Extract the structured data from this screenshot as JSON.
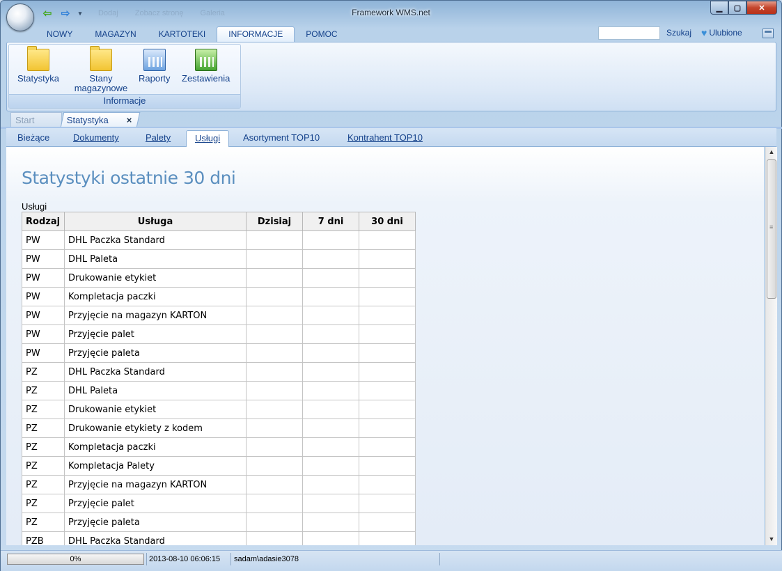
{
  "window": {
    "title": "Framework WMS.net",
    "ghost_qat": [
      "Dodaj",
      "Zobacz stronę",
      "Galeria"
    ]
  },
  "ribbon": {
    "tabs": [
      "NOWY",
      "MAGAZYN",
      "KARTOTEKI",
      "INFORMACJE",
      "POMOC"
    ],
    "active_tab": "INFORMACJE",
    "search_value": "",
    "search_label": "Szukaj",
    "favorites_label": "Ulubione",
    "group": {
      "label": "Informacje",
      "buttons": [
        {
          "label": "Statystyka",
          "icon": "folder-icon"
        },
        {
          "label": "Stany magazynowe",
          "icon": "folder-icon"
        },
        {
          "label": "Raporty",
          "icon": "bar-chart-icon"
        },
        {
          "label": "Zestawienia",
          "icon": "bar-chart-icon"
        }
      ]
    }
  },
  "doc_tabs": {
    "start": "Start",
    "active": "Statystyka",
    "close_glyph": "×"
  },
  "sub_tabs": [
    {
      "label": "Bieżące"
    },
    {
      "label": "Dokumenty"
    },
    {
      "label": "Palety"
    },
    {
      "label": "Usługi",
      "active": true
    },
    {
      "label": "Asortyment TOP10"
    },
    {
      "label": "Kontrahent TOP10"
    }
  ],
  "content": {
    "heading": "Statystyki ostatnie 30 dni",
    "table_caption": "Usługi",
    "columns": [
      "Rodzaj",
      "Usługa",
      "Dzisiaj",
      "7 dni",
      "30 dni"
    ],
    "rows": [
      [
        "PW",
        "DHL Paczka Standard",
        "",
        "",
        ""
      ],
      [
        "PW",
        "DHL Paleta",
        "",
        "",
        ""
      ],
      [
        "PW",
        "Drukowanie etykiet",
        "",
        "",
        ""
      ],
      [
        "PW",
        "Kompletacja paczki",
        "",
        "",
        ""
      ],
      [
        "PW",
        "Przyjęcie na magazyn KARTON",
        "",
        "",
        ""
      ],
      [
        "PW",
        "Przyjęcie palet",
        "",
        "",
        ""
      ],
      [
        "PW",
        "Przyjęcie paleta",
        "",
        "",
        ""
      ],
      [
        "PZ",
        "DHL Paczka Standard",
        "",
        "",
        ""
      ],
      [
        "PZ",
        "DHL Paleta",
        "",
        "",
        ""
      ],
      [
        "PZ",
        "Drukowanie etykiet",
        "",
        "",
        ""
      ],
      [
        "PZ",
        "Drukowanie etykiety z kodem",
        "",
        "",
        ""
      ],
      [
        "PZ",
        "Kompletacja paczki",
        "",
        "",
        ""
      ],
      [
        "PZ",
        "Kompletacja Palety",
        "",
        "",
        ""
      ],
      [
        "PZ",
        "Przyjęcie na magazyn KARTON",
        "",
        "",
        ""
      ],
      [
        "PZ",
        "Przyjęcie palet",
        "",
        "",
        ""
      ],
      [
        "PZ",
        "Przyjęcie paleta",
        "",
        "",
        ""
      ],
      [
        "PZB",
        "DHL Paczka Standard",
        "",
        "",
        ""
      ]
    ]
  },
  "status": {
    "progress_text": "0%",
    "progress_value": 0,
    "datetime": "2013-08-10 06:06:15",
    "user": "sadam\\adasie3078"
  },
  "colors": {
    "accent": "#15428b",
    "heading": "#5b8fbf",
    "ribbon_bg": "#dde9f7"
  }
}
